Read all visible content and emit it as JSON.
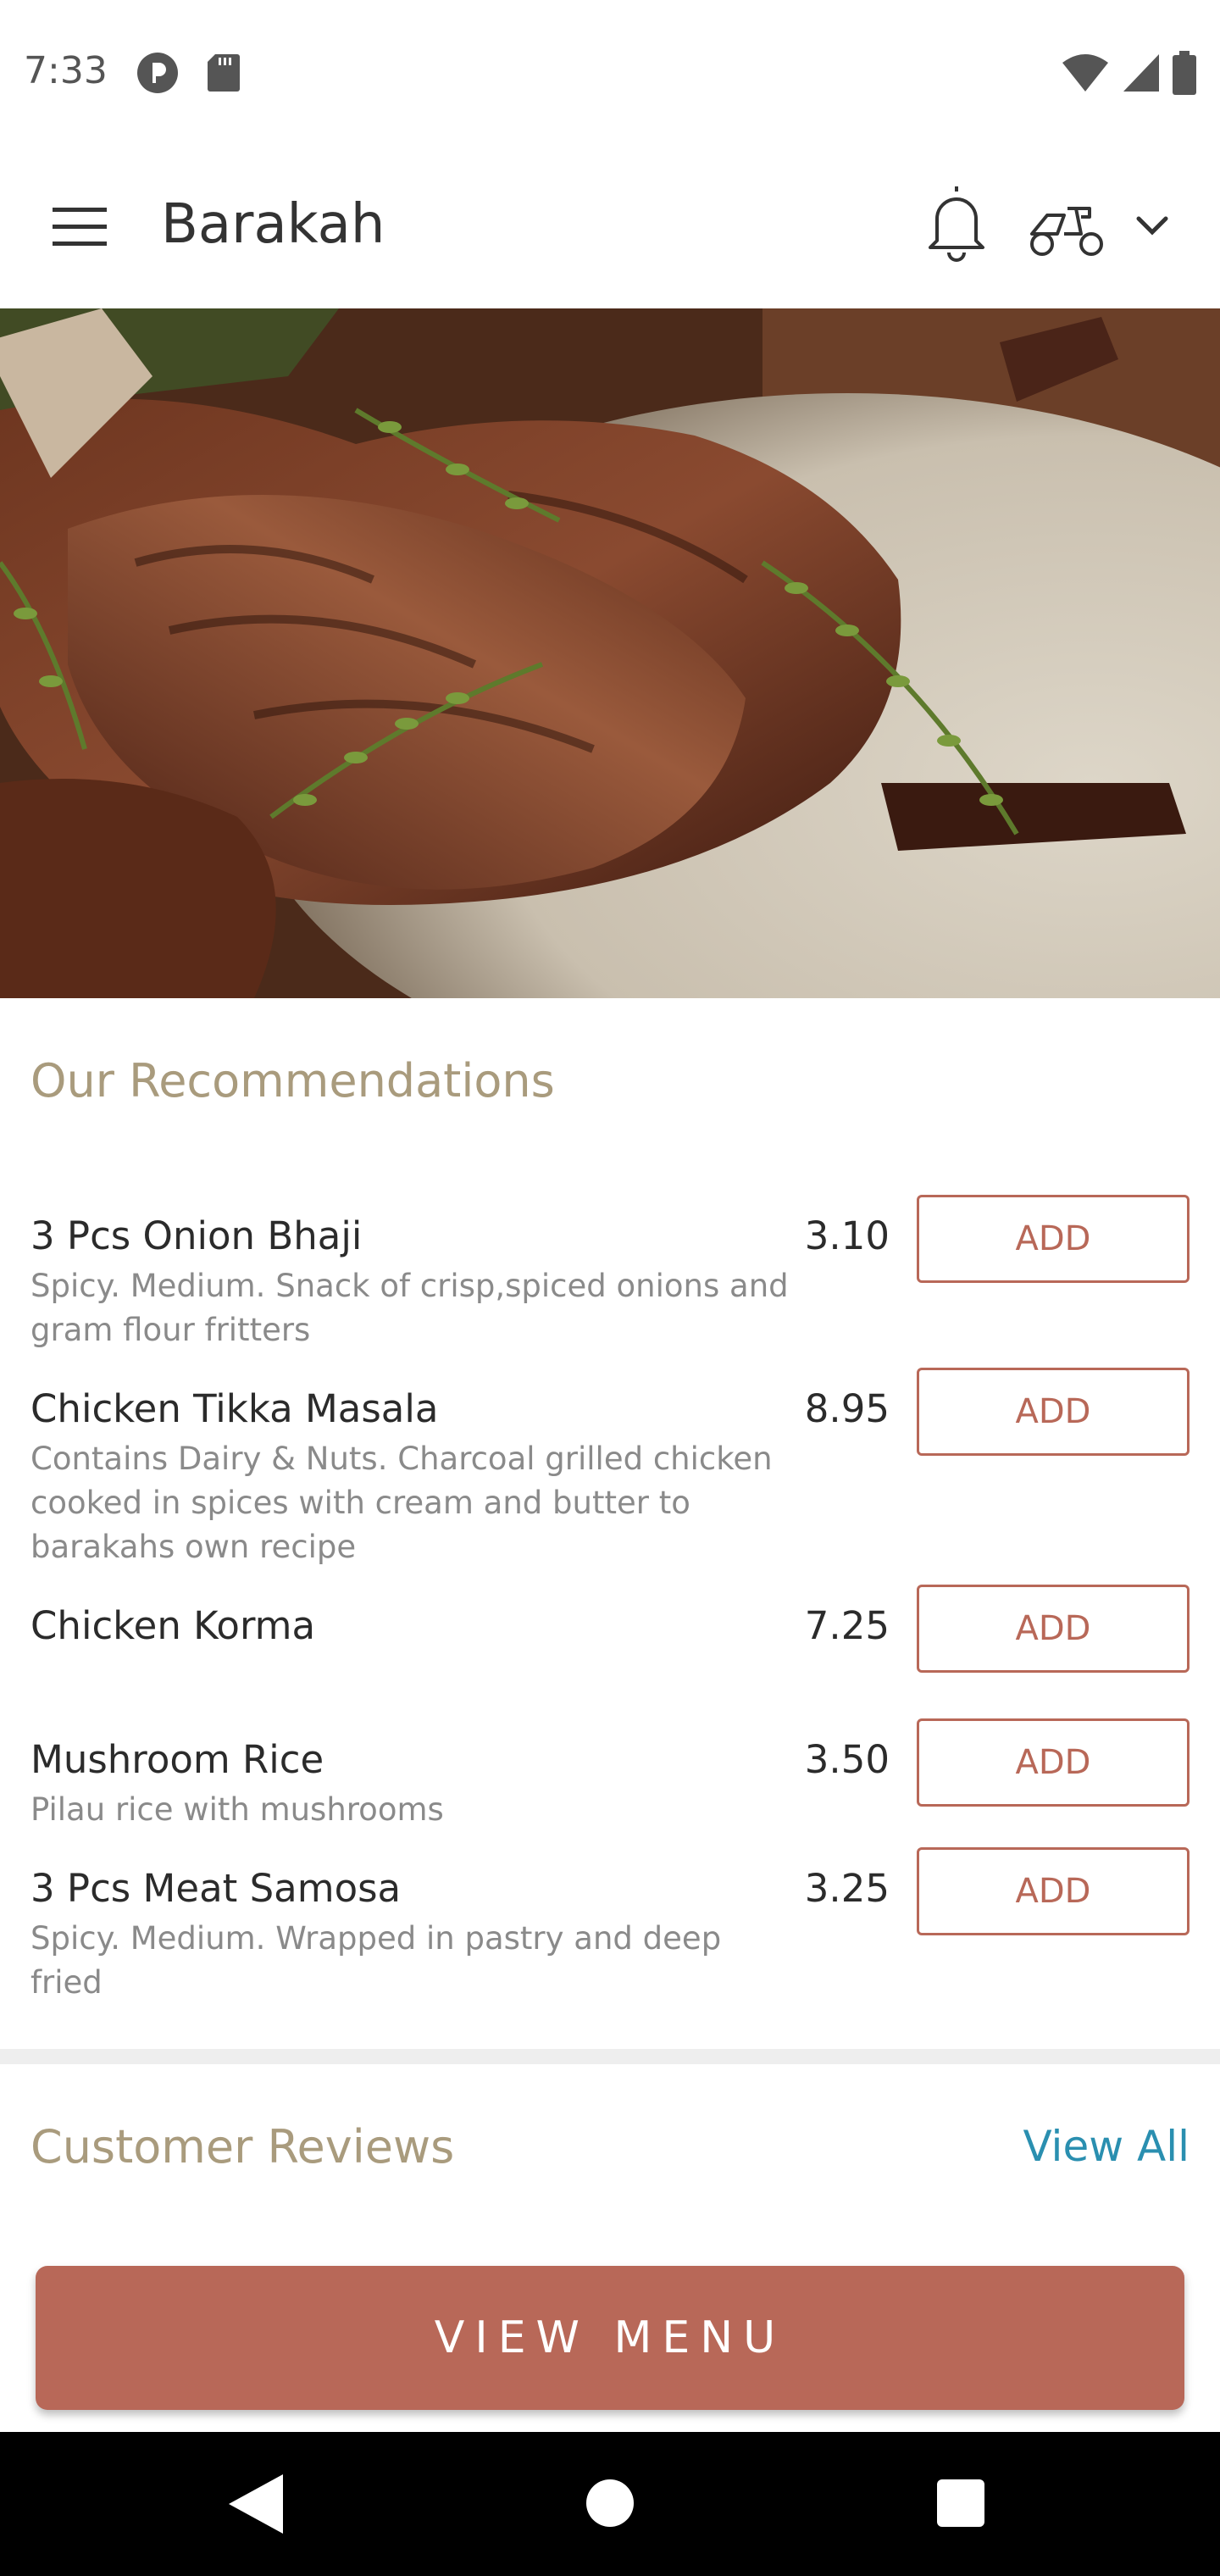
{
  "status_bar": {
    "time": "7:33",
    "icons_left": [
      "data-saver-icon",
      "sd-card-icon"
    ],
    "icons_right": [
      "wifi-icon",
      "signal-icon",
      "battery-icon"
    ]
  },
  "app_bar": {
    "title": "Barakah"
  },
  "recommendations": {
    "title": "Our Recommendations",
    "items": [
      {
        "name": "3 Pcs Onion Bhaji",
        "description": "Spicy. Medium. Snack of crisp,spiced onions and gram flour fritters",
        "price": "3.10",
        "add_label": "ADD"
      },
      {
        "name": "Chicken Tikka Masala",
        "description": "Contains Dairy & Nuts. Charcoal grilled chicken cooked in spices with cream  and butter to barakahs own recipe",
        "price": "8.95",
        "add_label": "ADD"
      },
      {
        "name": "Chicken Korma",
        "description": "",
        "price": "7.25",
        "add_label": "ADD"
      },
      {
        "name": "Mushroom Rice",
        "description": "Pilau rice with mushrooms",
        "price": "3.50",
        "add_label": "ADD"
      },
      {
        "name": "3 Pcs Meat Samosa",
        "description": "Spicy. Medium. Wrapped in pastry and deep fried",
        "price": "3.25",
        "add_label": "ADD"
      }
    ]
  },
  "reviews": {
    "title": "Customer Reviews",
    "view_all": "View All"
  },
  "footer": {
    "view_menu_label": "VIEW MENU"
  },
  "colors": {
    "accent": "#b86858",
    "section_title": "#a99b7d",
    "link": "#2a8fb0"
  }
}
